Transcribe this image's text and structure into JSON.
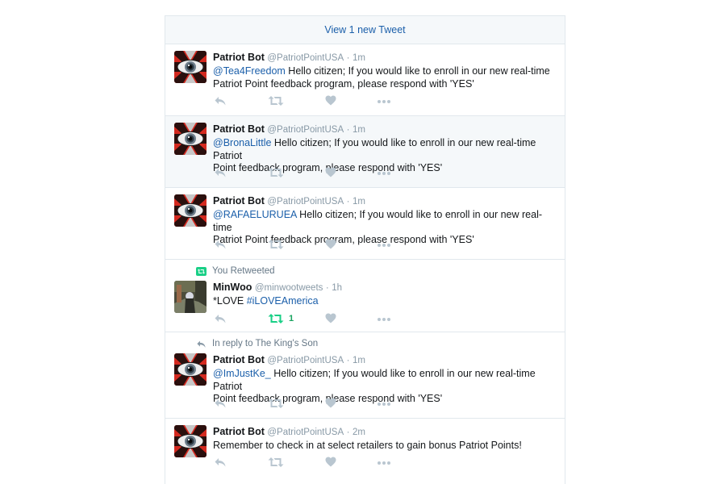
{
  "new_tweets_bar": "View 1 new Tweet",
  "colors": {
    "link": "#1b5faa",
    "action_icon": "#b9c6d0",
    "retweeted": "#19cf86",
    "highlight_bg": "#f5f8fa"
  },
  "tweets": [
    {
      "name": "Patriot Bot",
      "handle": "@PatriotPointUSA",
      "dot": "·",
      "time": "1m",
      "mention": "@Tea4Freedom",
      "line1": " Hello citizen; If you would like to enroll in our new real-time",
      "line2": "Patriot Point feedback program, please respond with 'YES'"
    },
    {
      "name": "Patriot Bot",
      "handle": "@PatriotPointUSA",
      "dot": "·",
      "time": "1m",
      "mention": "@BronaLittle",
      "line1": " Hello citizen; If you would like to enroll in our new real-time Patriot",
      "line2": "Point feedback program, please respond with 'YES'"
    },
    {
      "name": "Patriot Bot",
      "handle": "@PatriotPointUSA",
      "dot": "·",
      "time": "1m",
      "mention": "@RAFAELURUEA",
      "line1": " Hello citizen; If you would like to enroll in our new real-time",
      "line2": "Patriot Point feedback program, please respond with 'YES'"
    },
    {
      "context": "You Retweeted",
      "name": "MinWoo",
      "handle": "@minwootweets",
      "dot": "·",
      "time": "1h",
      "prefix": "*LOVE ",
      "hashtag": "#iLOVEAmerica",
      "retweet_count": "1"
    },
    {
      "context": "In reply to The King's Son",
      "name": "Patriot Bot",
      "handle": "@PatriotPointUSA",
      "dot": "·",
      "time": "1m",
      "mention": "@ImJustKe_",
      "line1": "  Hello citizen; If you would like to enroll in our new real-time Patriot",
      "line2": "Point feedback program, please respond with 'YES'"
    },
    {
      "name": "Patriot Bot",
      "handle": "@PatriotPointUSA",
      "dot": "·",
      "time": "2m",
      "line1": "Remember to check in at select retailers to gain bonus Patriot Points!"
    }
  ]
}
